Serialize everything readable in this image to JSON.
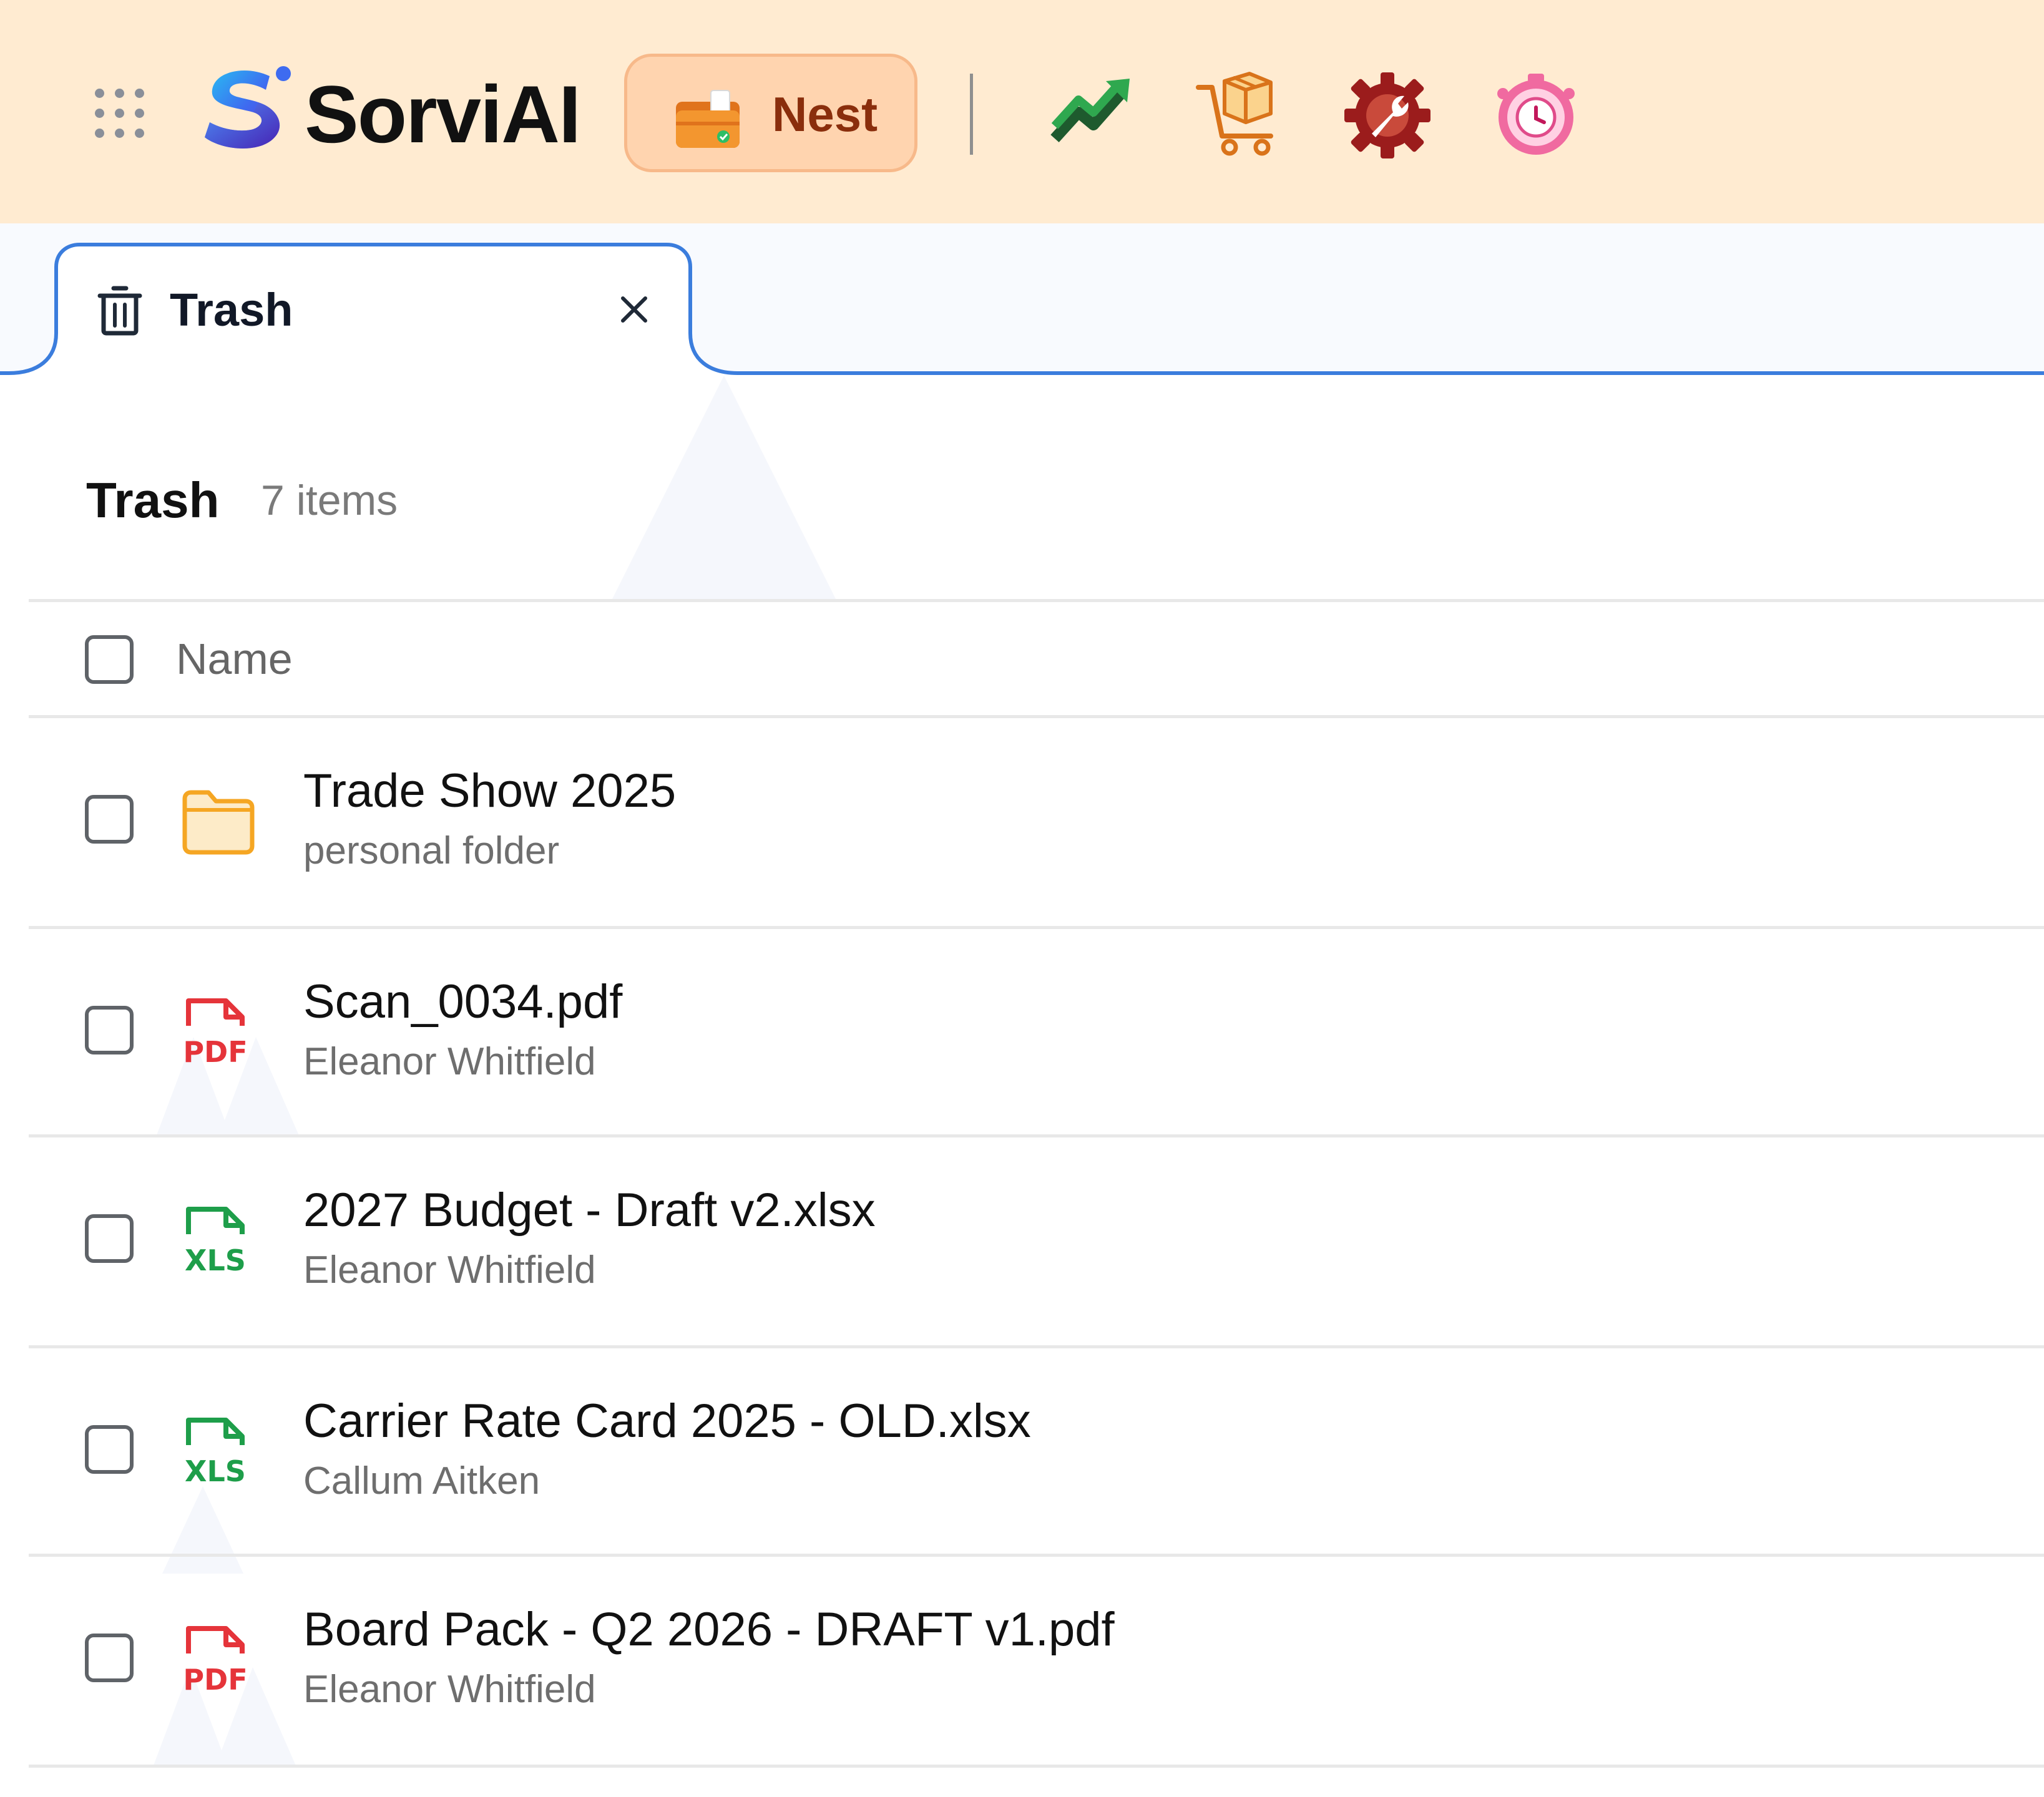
{
  "header": {
    "brand": "SorviAI",
    "active_app_label": "Nest",
    "apps": [
      {
        "name": "trending-chart-icon"
      },
      {
        "name": "shopping-cart-box-icon"
      },
      {
        "name": "gear-wrench-icon"
      },
      {
        "name": "pink-clock-icon"
      }
    ]
  },
  "tab": {
    "label": "Trash",
    "icon": "trash-icon"
  },
  "page": {
    "title": "Trash",
    "count": "7 items",
    "column_name": "Name"
  },
  "colors": {
    "header_bg": "#FFEBD1",
    "active_tab_border": "#3B7DDD",
    "pdf_red": "#E5343A",
    "xls_green": "#1E9E4A",
    "folder_yellow": "#F5A623"
  },
  "files": [
    {
      "name": "Trade Show 2025",
      "owner": "personal folder",
      "type": "folder"
    },
    {
      "name": "Scan_0034.pdf",
      "owner": "Eleanor Whitfield",
      "type": "pdf",
      "badge": "PDF"
    },
    {
      "name": "2027 Budget - Draft v2.xlsx",
      "owner": "Eleanor Whitfield",
      "type": "xls",
      "badge": "XLS"
    },
    {
      "name": "Carrier Rate Card 2025 - OLD.xlsx",
      "owner": "Callum Aitken",
      "type": "xls",
      "badge": "XLS"
    },
    {
      "name": "Board Pack - Q2 2026 - DRAFT v1.pdf",
      "owner": "Eleanor Whitfield",
      "type": "pdf",
      "badge": "PDF"
    }
  ]
}
